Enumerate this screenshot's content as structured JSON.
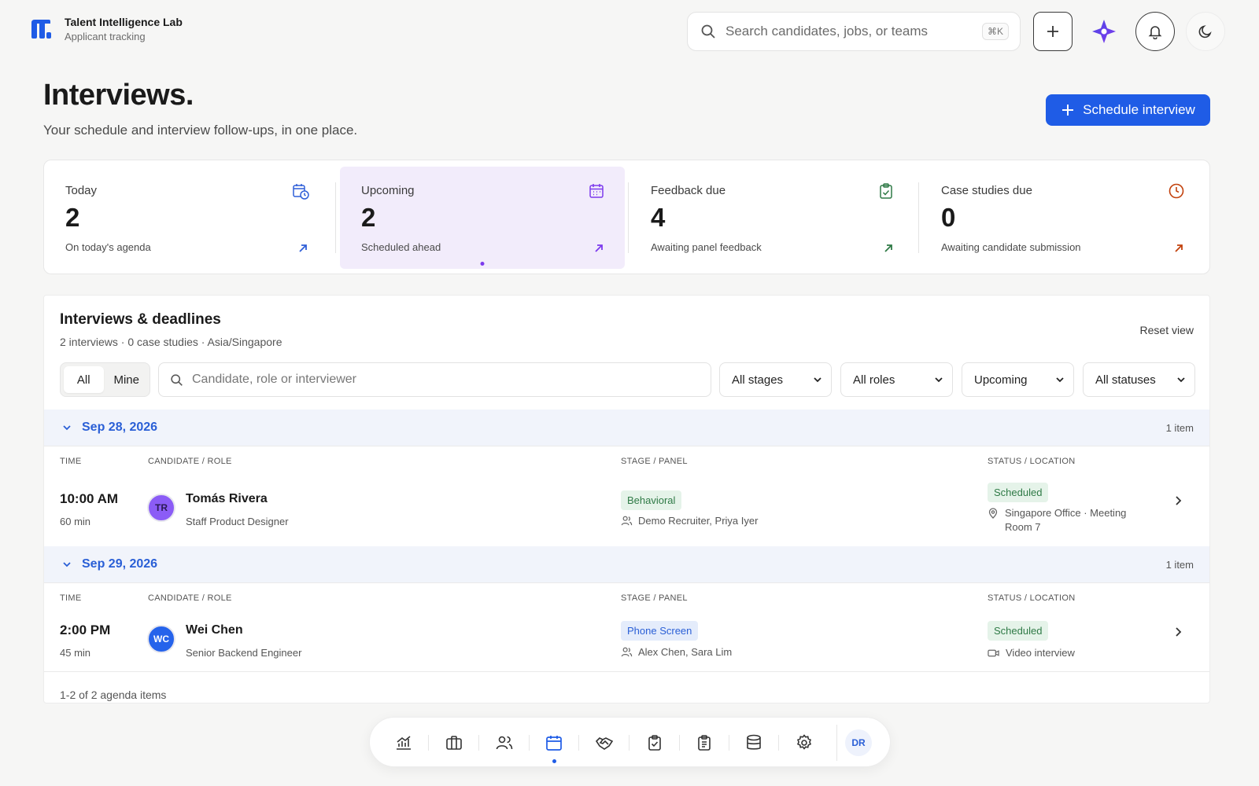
{
  "app": {
    "name": "Talent Intelligence Lab",
    "subtitle": "Applicant tracking"
  },
  "header": {
    "search_placeholder": "Search candidates, jobs, or teams",
    "shortcut": "⌘K",
    "icons": [
      "plus-icon",
      "sparkle-icon",
      "bell-icon",
      "moon-icon"
    ]
  },
  "page": {
    "title": "Interviews.",
    "subtitle": "Your schedule and interview follow-ups, in one place.",
    "primary_action": "Schedule interview"
  },
  "stats": [
    {
      "label": "Today",
      "value": "2",
      "foot": "On today's agenda",
      "color": "#2f5fd8",
      "icon": "calendar-clock-icon"
    },
    {
      "label": "Upcoming",
      "value": "2",
      "foot": "Scheduled ahead",
      "color": "#7c3aed",
      "icon": "calendar-icon",
      "active": true
    },
    {
      "label": "Feedback due",
      "value": "4",
      "foot": "Awaiting panel feedback",
      "color": "#2f7a46",
      "icon": "clipboard-check-icon"
    },
    {
      "label": "Case studies due",
      "value": "0",
      "foot": "Awaiting candidate submission",
      "color": "#c2410c",
      "icon": "clock-icon"
    }
  ],
  "panel": {
    "title": "Interviews & deadlines",
    "subtitle": "2 interviews · 0 case studies · Asia/Singapore",
    "reset": "Reset view",
    "segments": [
      "All",
      "Mine"
    ],
    "filter_placeholder": "Candidate, role or interviewer",
    "selects": [
      "All stages",
      "All roles",
      "Upcoming",
      "All statuses"
    ],
    "columns": [
      "TIME",
      "CANDIDATE / ROLE",
      "STAGE / PANEL",
      "STATUS / LOCATION"
    ],
    "groups": [
      {
        "date": "Sep 28, 2026",
        "count": "1 item",
        "row": {
          "time": "10:00 AM",
          "duration": "60 min",
          "initials": "TR",
          "name": "Tomás Rivera",
          "role": "Staff Product Designer",
          "stage": "Behavioral",
          "panel": "Demo Recruiter, Priya Iyer",
          "status": "Scheduled",
          "location": "Singapore Office · Meeting Room 7"
        }
      },
      {
        "date": "Sep 29, 2026",
        "count": "1 item",
        "row": {
          "time": "2:00 PM",
          "duration": "45 min",
          "initials": "WC",
          "name": "Wei Chen",
          "role": "Senior Backend Engineer",
          "stage": "Phone Screen",
          "panel": "Alex Chen, Sara Lim",
          "status": "Scheduled",
          "location": "Video interview"
        }
      }
    ],
    "pager": "1-2 of 2 agenda items"
  },
  "dock": {
    "items": [
      "analytics-icon",
      "jobs-icon",
      "candidates-icon",
      "interviews-icon",
      "offers-icon",
      "tasks-icon",
      "forms-icon",
      "database-icon",
      "settings-icon"
    ],
    "active": "interviews-icon",
    "user_initials": "DR"
  }
}
